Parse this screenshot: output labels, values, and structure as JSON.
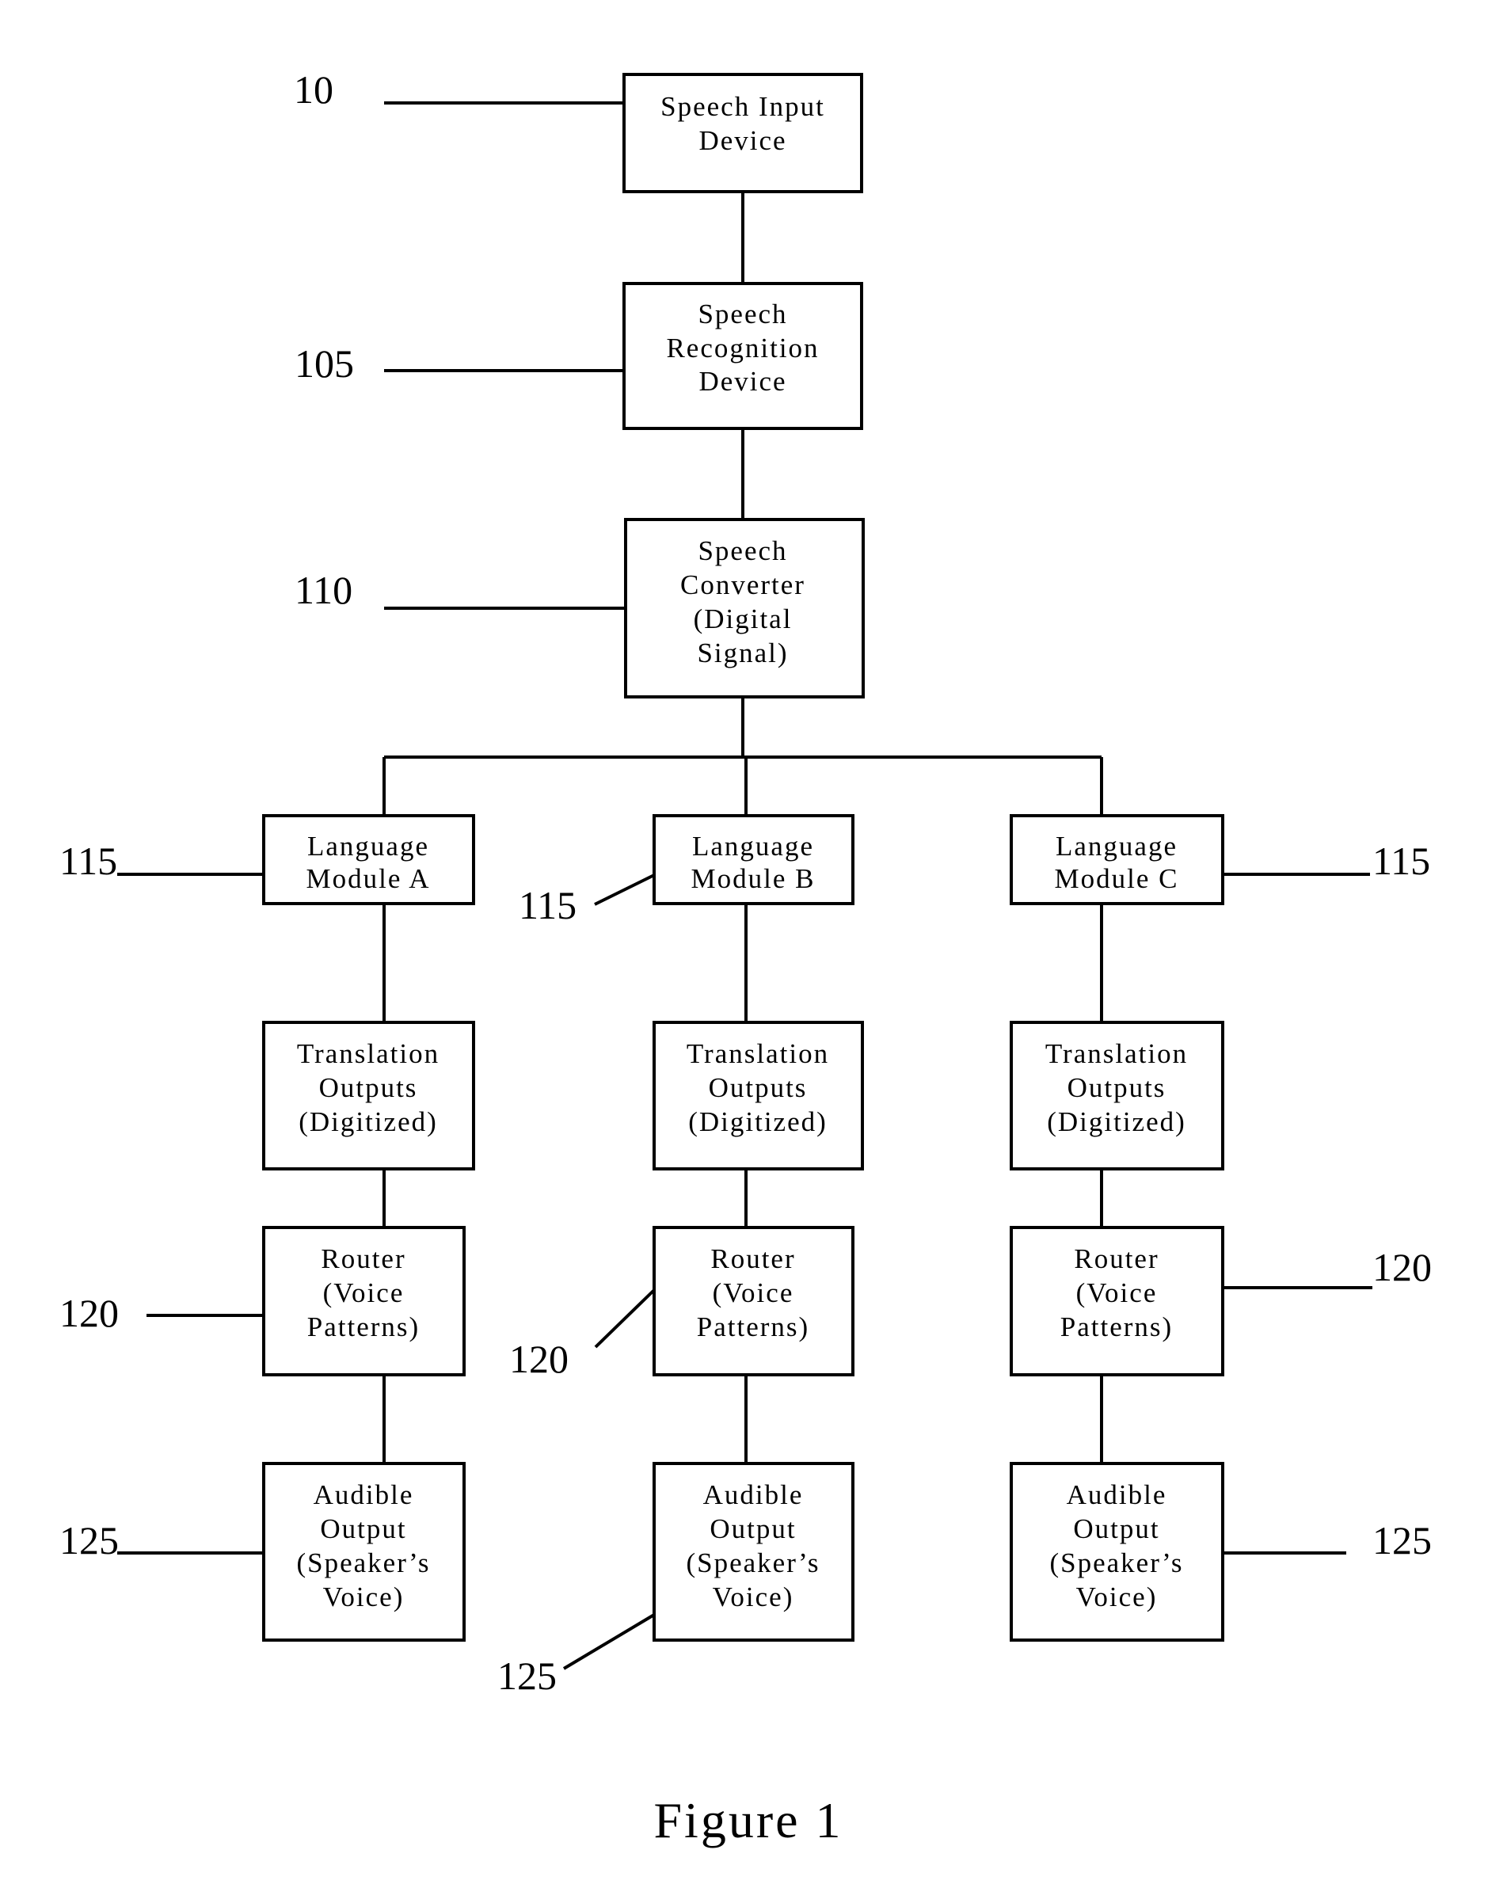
{
  "figure": {
    "caption": "Figure 1",
    "stroke_color": "#000000",
    "background_color": "#ffffff"
  },
  "blocks": {
    "speech_input": {
      "ref": "10",
      "lines": [
        "Speech Input",
        "Device"
      ]
    },
    "speech_recognition": {
      "ref": "105",
      "lines": [
        "Speech",
        "Recognition",
        "Device"
      ]
    },
    "speech_converter": {
      "ref": "110",
      "lines": [
        "Speech",
        "Converter",
        "(Digital",
        "Signal)"
      ]
    }
  },
  "columns": [
    {
      "id": "A",
      "language_module": {
        "ref": "115",
        "lines": [
          "Language",
          "Module A"
        ]
      },
      "translation": {
        "lines": [
          "Translation",
          "Outputs",
          "(Digitized)"
        ]
      },
      "router": {
        "ref": "120",
        "lines": [
          "Router",
          "(Voice",
          "Patterns)"
        ]
      },
      "audible": {
        "ref": "125",
        "lines": [
          "Audible",
          "Output",
          "(Speaker’s",
          "Voice)"
        ]
      }
    },
    {
      "id": "B",
      "language_module": {
        "ref": "115",
        "lines": [
          "Language",
          "Module B"
        ]
      },
      "translation": {
        "lines": [
          "Translation",
          "Outputs",
          "(Digitized)"
        ]
      },
      "router": {
        "ref": "120",
        "lines": [
          "Router",
          "(Voice",
          "Patterns)"
        ]
      },
      "audible": {
        "ref": "125",
        "lines": [
          "Audible",
          "Output",
          "(Speaker’s",
          "Voice)"
        ]
      }
    },
    {
      "id": "C",
      "language_module": {
        "ref": "115",
        "lines": [
          "Language",
          "Module C"
        ]
      },
      "translation": {
        "lines": [
          "Translation",
          "Outputs",
          "(Digitized)"
        ]
      },
      "router": {
        "ref": "120",
        "lines": [
          "Router",
          "(Voice",
          "Patterns)"
        ]
      },
      "audible": {
        "ref": "125",
        "lines": [
          "Audible",
          "Output",
          "(Speaker’s",
          "Voice)"
        ]
      }
    }
  ]
}
